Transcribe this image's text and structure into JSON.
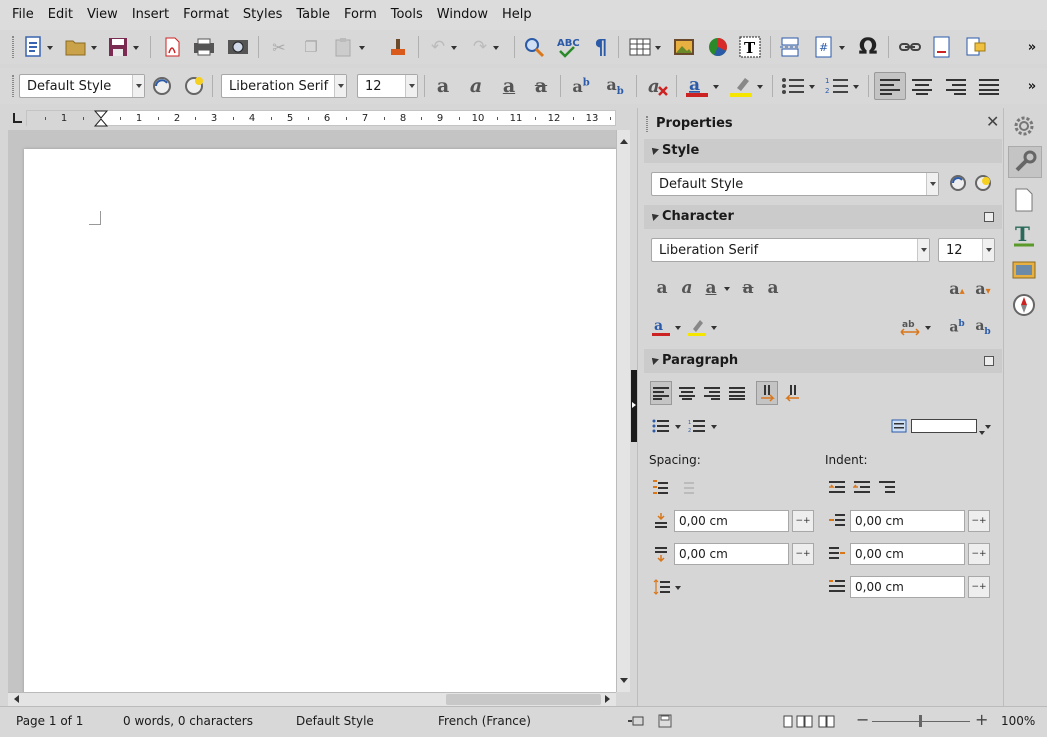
{
  "menu": [
    "File",
    "Edit",
    "View",
    "Insert",
    "Format",
    "Styles",
    "Table",
    "Form",
    "Tools",
    "Window",
    "Help"
  ],
  "formatting": {
    "paragraph_style": "Default Style",
    "font_name": "Liberation Serif",
    "font_size": "12"
  },
  "ruler": {
    "numbers": [
      "1",
      "1",
      "2",
      "3",
      "4",
      "5",
      "6",
      "7",
      "8",
      "9",
      "10",
      "11",
      "12",
      "13"
    ]
  },
  "sidebar": {
    "title": "Properties",
    "style_section": {
      "label": "Style",
      "value": "Default Style"
    },
    "character_section": {
      "label": "Character",
      "font": "Liberation Serif",
      "size": "12"
    },
    "paragraph_section": {
      "label": "Paragraph",
      "spacing_label": "Spacing:",
      "indent_label": "Indent:",
      "above_spacing": "0,00 cm",
      "below_spacing": "0,00 cm",
      "before_indent": "0,00 cm",
      "after_indent": "0,00 cm",
      "first_line_indent": "0,00 cm"
    }
  },
  "status": {
    "page": "Page 1 of 1",
    "words": "0 words, 0 characters",
    "style": "Default Style",
    "language": "French (France)",
    "zoom": "100%"
  },
  "colors": {
    "accent_red": "#cc2222",
    "highlight_yellow": "#f5e500",
    "theme_blue": "#3a64b0"
  }
}
